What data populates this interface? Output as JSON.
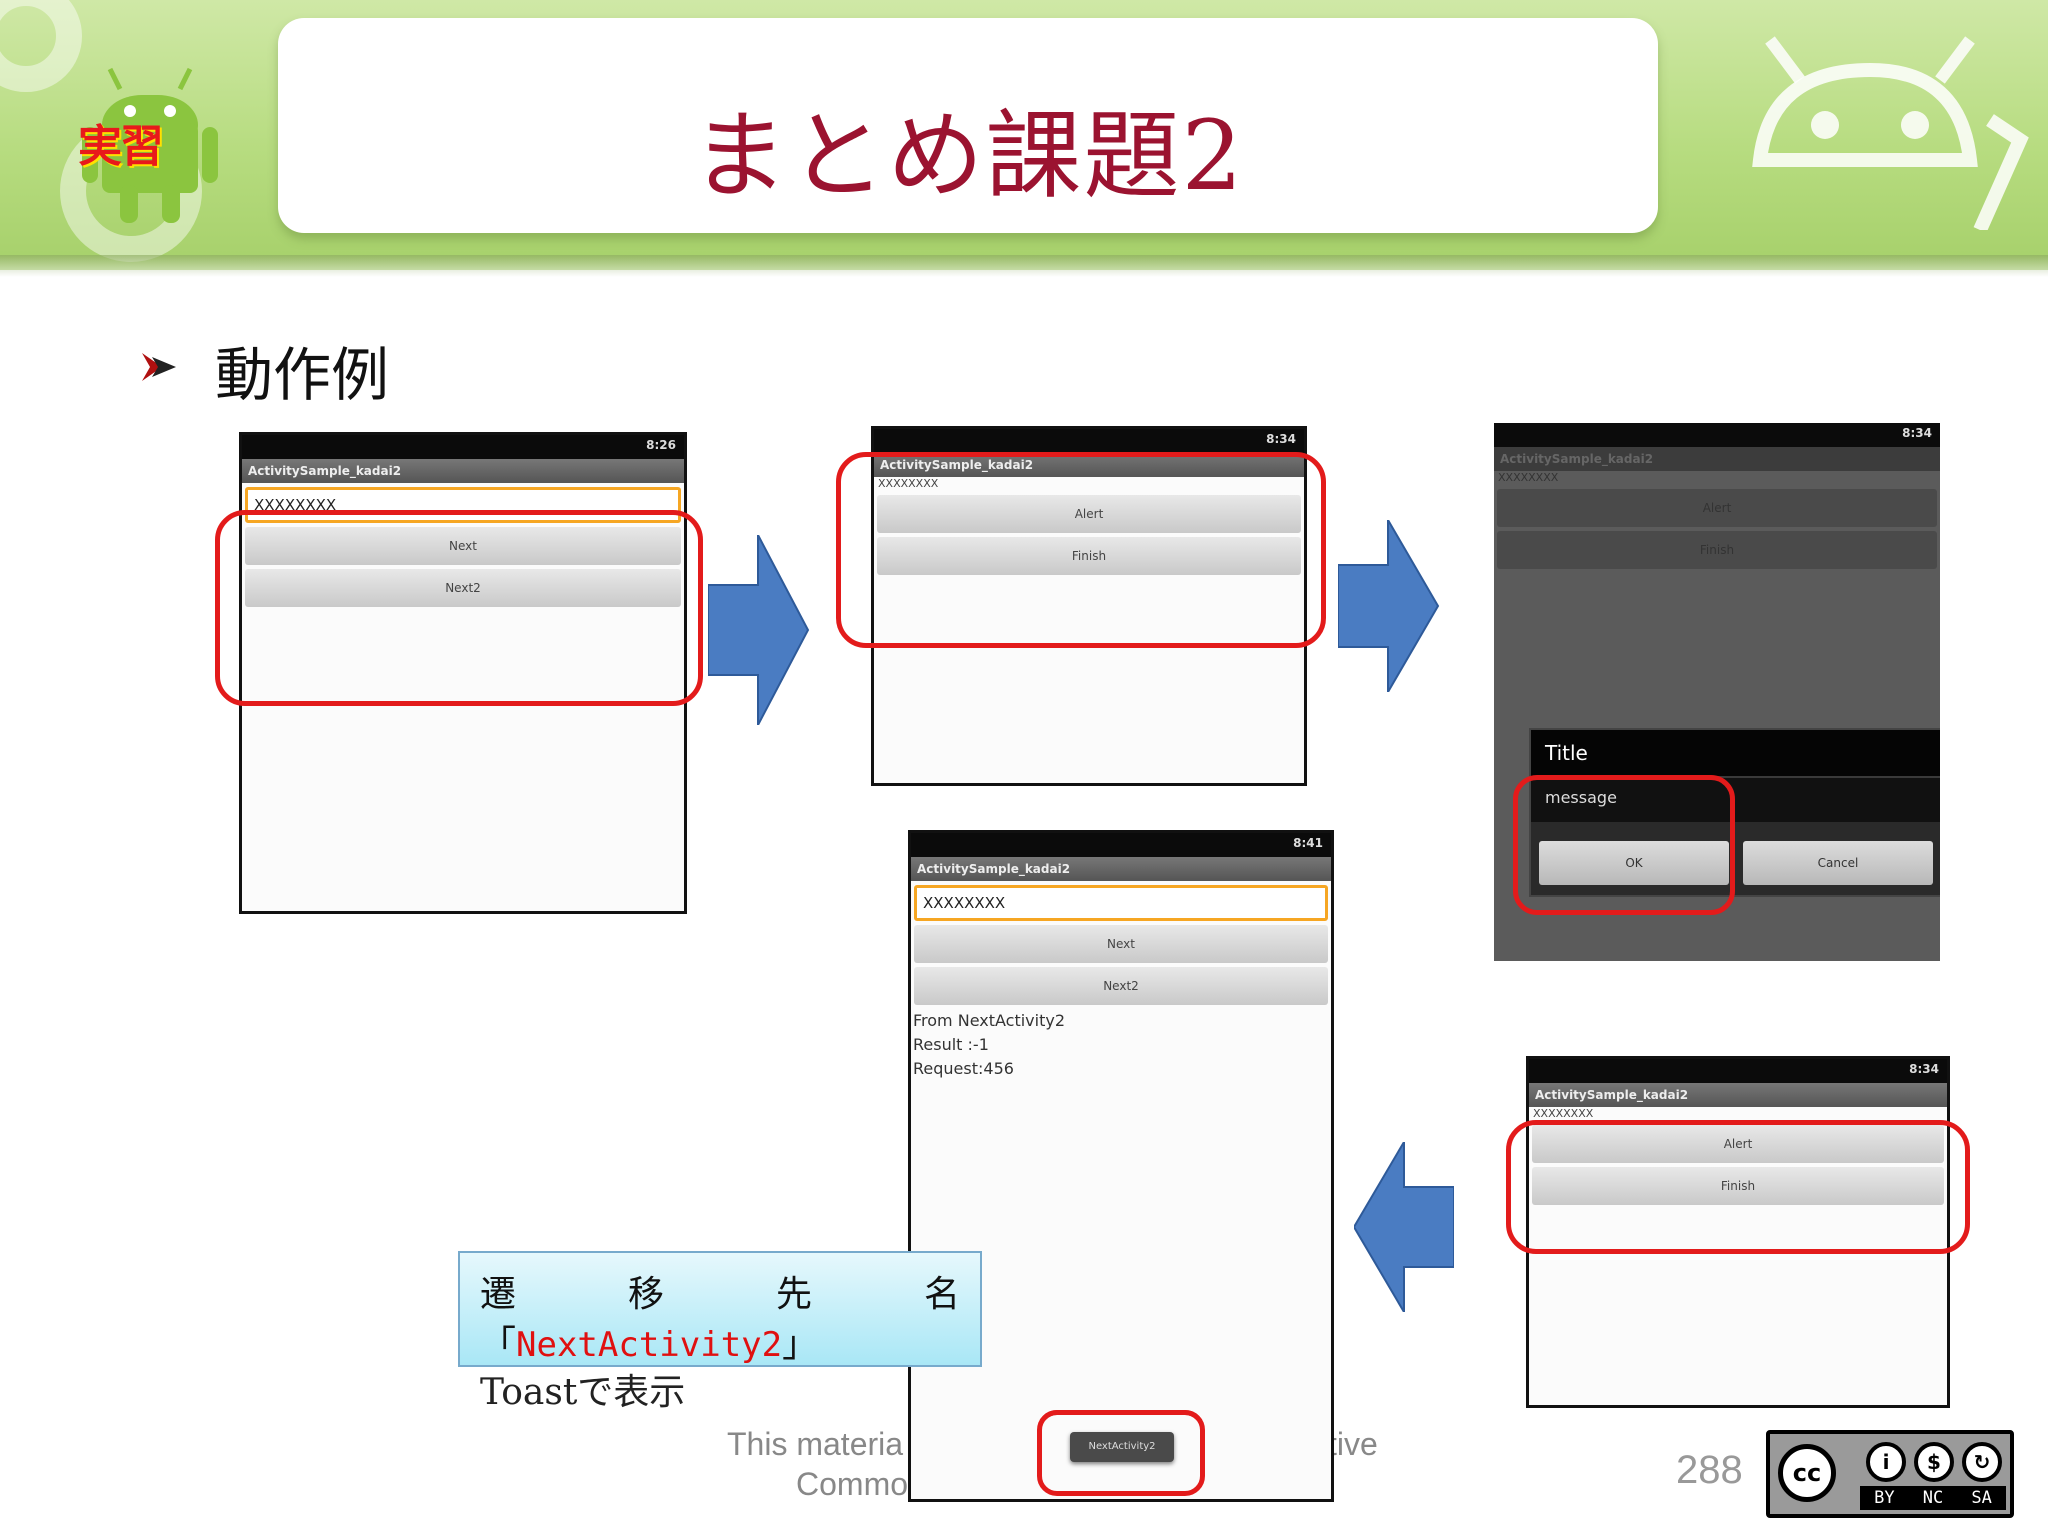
{
  "slide": {
    "title": "まとめ課題2",
    "badge": "実習",
    "bullet": "動作例",
    "page_number": "288"
  },
  "phones": {
    "p1": {
      "clock": "8:26",
      "app_title": "ActivitySample_kadai2",
      "edit_value": "XXXXXXXX",
      "buttons": [
        "Next",
        "Next2"
      ]
    },
    "p2": {
      "clock": "8:34",
      "app_title": "ActivitySample_kadai2",
      "label": "XXXXXXXX",
      "buttons": [
        "Alert",
        "Finish"
      ]
    },
    "p3": {
      "clock": "8:34",
      "app_title": "ActivitySample_kadai2",
      "label": "XXXXXXXX",
      "buttons": [
        "Alert",
        "Finish"
      ],
      "dialog_title": "Title",
      "dialog_message": "message",
      "dialog_ok": "OK",
      "dialog_cancel": "Cancel"
    },
    "p4": {
      "clock": "8:41",
      "app_title": "ActivitySample_kadai2",
      "edit_value": "XXXXXXXX",
      "buttons": [
        "Next",
        "Next2"
      ],
      "result_lines": [
        "From NextActivity2",
        "Result :-1",
        "Request:456"
      ],
      "toast": "NextActivity2"
    },
    "p5": {
      "clock": "8:34",
      "app_title": "ActivitySample_kadai2",
      "label": "XXXXXXXX",
      "buttons": [
        "Alert",
        "Finish"
      ]
    }
  },
  "note": {
    "chars": [
      "遷",
      "移",
      "先",
      "名"
    ],
    "open_bracket": "「",
    "activity": "NextActivity2",
    "close_bracket": "」",
    "line3": "Toastで表示"
  },
  "footer": {
    "part1": "This materia",
    "part2": "tive",
    "part3": "Commo",
    "license_labels": [
      "BY",
      "NC",
      "SA"
    ],
    "cc": "cc"
  },
  "colors": {
    "title": "#9b1330",
    "highlight": "#e31b1b",
    "arrow": "#4a7cc2",
    "banner": "#b7dc80"
  }
}
